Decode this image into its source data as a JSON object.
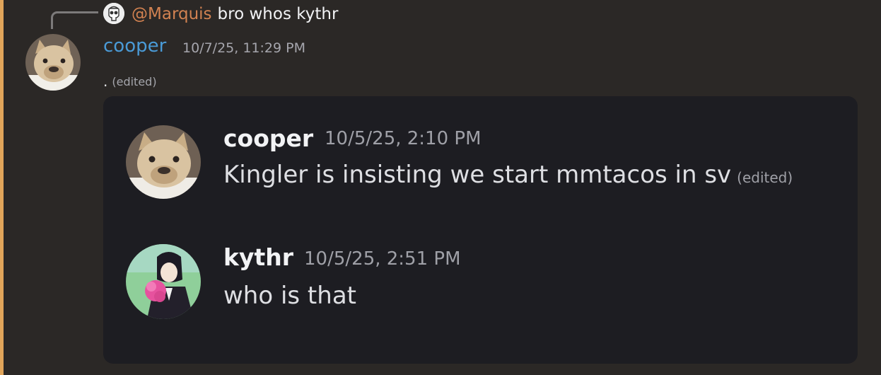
{
  "reply": {
    "mention": "@Marquis",
    "text": "bro whos kythr",
    "avatar_icon": "skull-avatar-icon"
  },
  "message": {
    "author": "cooper",
    "timestamp": "10/7/25, 11:29 PM",
    "content": ".",
    "edited_label": "(edited)",
    "avatar_icon": "french-bulldog-avatar"
  },
  "embed": {
    "messages": [
      {
        "author": "cooper",
        "timestamp": "10/5/25, 2:10 PM",
        "text": "Kingler is insisting we start mmtacos in sv",
        "edited_label": "(edited)",
        "avatar_icon": "french-bulldog-avatar"
      },
      {
        "author": "kythr",
        "timestamp": "10/5/25, 2:51 PM",
        "text": "who is that",
        "avatar_icon": "anime-girl-avatar"
      }
    ]
  },
  "colors": {
    "background": "#2b2826",
    "left_stripe": "#e1a55a",
    "mention": "#d28251",
    "author_name": "#4a9ad6",
    "embed_background": "#1d1d22"
  }
}
